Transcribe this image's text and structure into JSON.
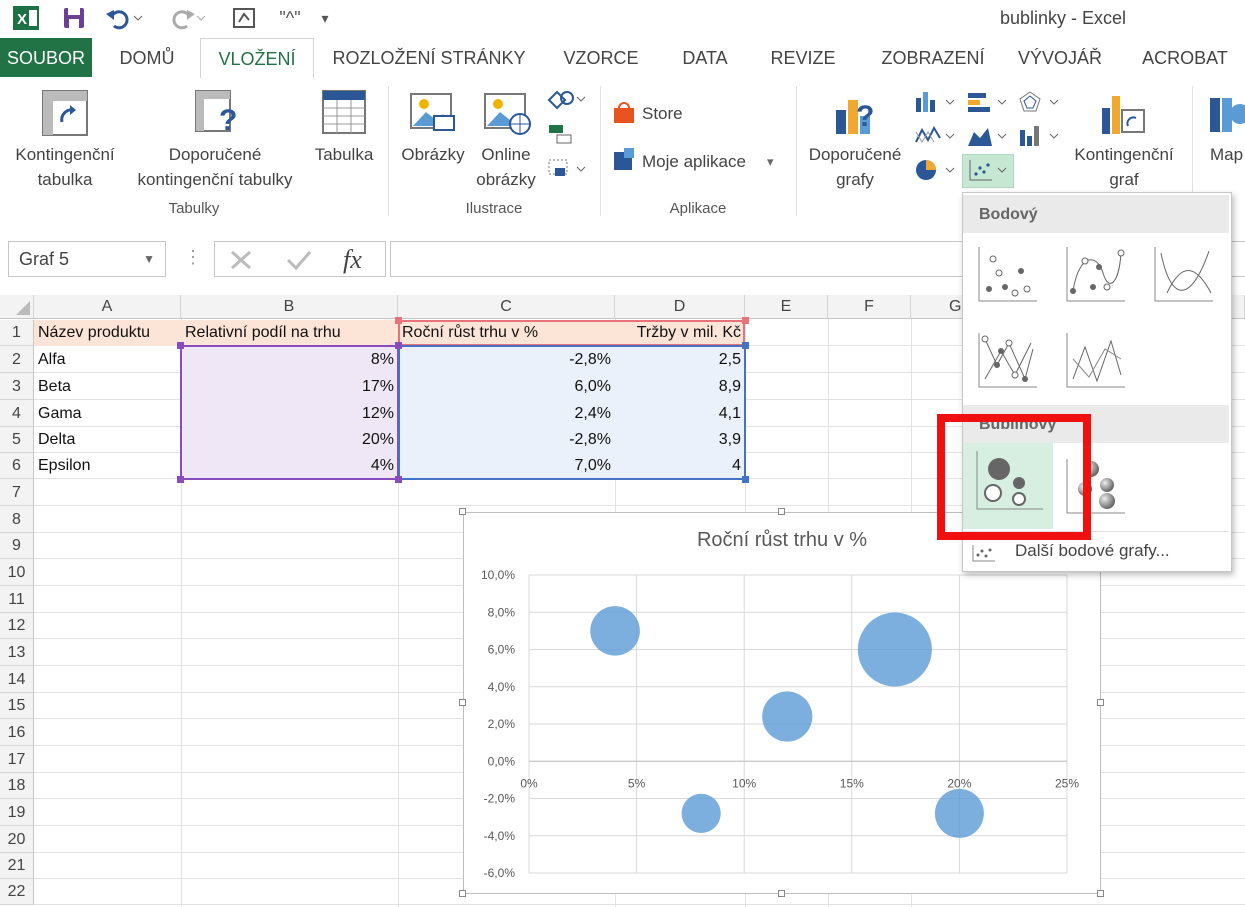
{
  "window": {
    "title": "bublinky - Excel"
  },
  "quick_access": {
    "save": "save-icon",
    "undo": "undo-icon",
    "redo": "redo-icon",
    "customize": "customize-icon"
  },
  "tabs": [
    {
      "label": "SOUBOR"
    },
    {
      "label": "DOMŮ"
    },
    {
      "label": "VLOŽENÍ"
    },
    {
      "label": "ROZLOŽENÍ STRÁNKY"
    },
    {
      "label": "VZORCE"
    },
    {
      "label": "DATA"
    },
    {
      "label": "REVIZE"
    },
    {
      "label": "ZOBRAZENÍ"
    },
    {
      "label": "VÝVOJÁŘ"
    },
    {
      "label": "ACROBAT"
    }
  ],
  "ribbon": {
    "pivot_table": [
      "Kontingenční",
      "tabulka"
    ],
    "recommended_pivot": [
      "Doporučené",
      "kontingenční tabulky"
    ],
    "table": "Tabulka",
    "group_tables": "Tabulky",
    "pictures": "Obrázky",
    "online_pictures": [
      "Online",
      "obrázky"
    ],
    "group_illustrations": "Ilustrace",
    "store": "Store",
    "my_apps": "Moje aplikace",
    "group_apps": "Aplikace",
    "recommended_charts": [
      "Doporučené",
      "grafy"
    ],
    "pivot_chart": [
      "Kontingenční",
      "graf"
    ],
    "maps": "Map"
  },
  "formula_bar": {
    "name_box": "Graf 5",
    "formula": ""
  },
  "columns": [
    "A",
    "B",
    "C",
    "D",
    "E",
    "F",
    "G"
  ],
  "rows": [
    "1",
    "2",
    "3",
    "4",
    "5",
    "6",
    "7",
    "8",
    "9",
    "10",
    "11",
    "12",
    "13",
    "14",
    "15",
    "16",
    "17",
    "18",
    "19",
    "20",
    "21",
    "22"
  ],
  "sheet": {
    "headers": [
      "Název produktu",
      "Relativní podíl na trhu",
      "Roční růst trhu v %",
      "Tržby v mil. Kč"
    ],
    "data": [
      [
        "Alfa",
        "8%",
        "-2,8%",
        "2,5"
      ],
      [
        "Beta",
        "17%",
        "6,0%",
        "8,9"
      ],
      [
        "Gama",
        "12%",
        "2,4%",
        "4,1"
      ],
      [
        "Delta",
        "20%",
        "-2,8%",
        "3,9"
      ],
      [
        "Epsilon",
        "4%",
        "7,0%",
        "4"
      ]
    ]
  },
  "colors": {
    "excel_green": "#217346",
    "bubble": "#5b9bd5",
    "highlight": "#f01010",
    "header_fill": "#fce4d6"
  },
  "chart_data": {
    "type": "bubble",
    "title": "Roční růst trhu v %",
    "x": [
      0.08,
      0.17,
      0.12,
      0.2,
      0.04
    ],
    "y": [
      -0.028,
      0.06,
      0.024,
      -0.028,
      0.07
    ],
    "size": [
      2.5,
      8.9,
      4.1,
      3.9,
      4
    ],
    "xlim": [
      0,
      0.25
    ],
    "ylim": [
      -0.06,
      0.1
    ],
    "x_ticks": [
      "0%",
      "5%",
      "10%",
      "15%",
      "20%",
      "25%"
    ],
    "y_ticks": [
      "10,0%",
      "8,0%",
      "6,0%",
      "4,0%",
      "2,0%",
      "0,0%",
      "-2,0%",
      "-4,0%",
      "-6,0%"
    ],
    "grid": true
  },
  "dropdown": {
    "scatter_header": "Bodový",
    "bubble_header": "Bublinový",
    "more": "Další bodové grafy..."
  }
}
